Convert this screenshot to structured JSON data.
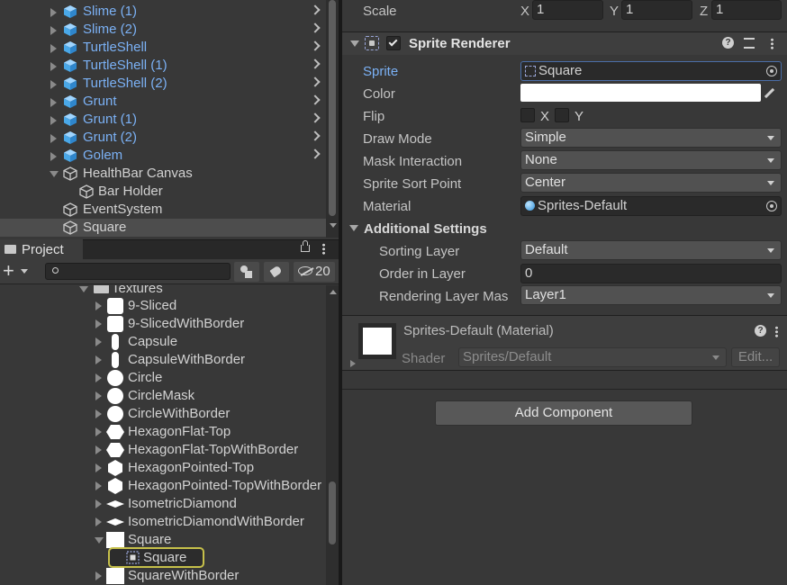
{
  "hierarchy": {
    "items": [
      {
        "label": "Slime (1)",
        "prefab": true,
        "expandable": true
      },
      {
        "label": "Slime (2)",
        "prefab": true,
        "expandable": true
      },
      {
        "label": "TurtleShell",
        "prefab": true,
        "expandable": true
      },
      {
        "label": "TurtleShell (1)",
        "prefab": true,
        "expandable": true
      },
      {
        "label": "TurtleShell (2)",
        "prefab": true,
        "expandable": true
      },
      {
        "label": "Grunt",
        "prefab": true,
        "expandable": true
      },
      {
        "label": "Grunt (1)",
        "prefab": true,
        "expandable": true
      },
      {
        "label": "Grunt (2)",
        "prefab": true,
        "expandable": true
      },
      {
        "label": "Golem",
        "prefab": true,
        "expandable": true
      },
      {
        "label": "HealthBar Canvas",
        "prefab": false,
        "expandable": false
      },
      {
        "label": "Bar Holder",
        "prefab": false,
        "expandable": false
      },
      {
        "label": "EventSystem",
        "prefab": false,
        "expandable": false
      },
      {
        "label": "Square",
        "prefab": false,
        "expandable": false,
        "selected": true
      }
    ]
  },
  "project": {
    "tab_label": "Project",
    "add_label": "+",
    "hidden_count": "20",
    "folder_label": "Textures",
    "items": [
      {
        "label": "9-Sliced",
        "shape": "rounded-square"
      },
      {
        "label": "9-SlicedWithBorder",
        "shape": "rounded-square"
      },
      {
        "label": "Capsule",
        "shape": "capsule"
      },
      {
        "label": "CapsuleWithBorder",
        "shape": "capsule"
      },
      {
        "label": "Circle",
        "shape": "circle"
      },
      {
        "label": "CircleMask",
        "shape": "circle"
      },
      {
        "label": "CircleWithBorder",
        "shape": "circle"
      },
      {
        "label": "HexagonFlat-Top",
        "shape": "hex-flat"
      },
      {
        "label": "HexagonFlat-TopWithBorder",
        "shape": "hex-flat"
      },
      {
        "label": "HexagonPointed-Top",
        "shape": "hex-pointed"
      },
      {
        "label": "HexagonPointed-TopWithBorder",
        "shape": "hex-pointed"
      },
      {
        "label": "IsometricDiamond",
        "shape": "diamond"
      },
      {
        "label": "IsometricDiamondWithBorder",
        "shape": "diamond"
      },
      {
        "label": "Square",
        "shape": "square",
        "expanded": true
      },
      {
        "label": "Square",
        "shape": "sprite",
        "child": true,
        "highlighted": true
      },
      {
        "label": "SquareWithBorder",
        "shape": "square"
      }
    ]
  },
  "inspector": {
    "scale": {
      "label": "Scale",
      "x_label": "X",
      "x": "1",
      "y_label": "Y",
      "y": "1",
      "z_label": "Z",
      "z": "1"
    },
    "sprite_renderer": {
      "title": "Sprite Renderer",
      "enabled": true,
      "sprite_label": "Sprite",
      "sprite_value": "Square",
      "color_label": "Color",
      "color_value": "#ffffff",
      "flip_label": "Flip",
      "flip_x_label": "X",
      "flip_y_label": "Y",
      "draw_mode_label": "Draw Mode",
      "draw_mode": "Simple",
      "mask_label": "Mask Interaction",
      "mask": "None",
      "sort_point_label": "Sprite Sort Point",
      "sort_point": "Center",
      "material_label": "Material",
      "material": "Sprites-Default",
      "additional_label": "Additional Settings",
      "sorting_layer_label": "Sorting Layer",
      "sorting_layer": "Default",
      "order_label": "Order in Layer",
      "order": "0",
      "rendering_layer_label": "Rendering Layer Mas",
      "rendering_layer": "Layer1"
    },
    "material_section": {
      "title": "Sprites-Default (Material)",
      "shader_label": "Shader",
      "shader": "Sprites/Default",
      "edit_label": "Edit..."
    },
    "add_component_label": "Add Component"
  },
  "colors": {
    "prefab_blue": "#7bb1f5",
    "selected_row": "#4d4d4d",
    "highlight_outline": "#c6c04a",
    "cube_blue": "#4aa8e8"
  }
}
